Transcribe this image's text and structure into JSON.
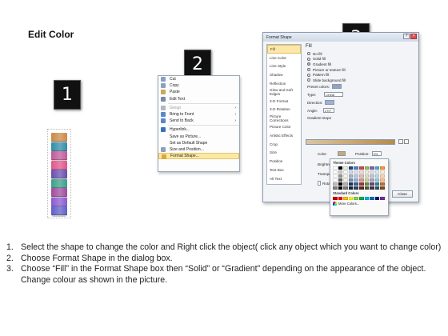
{
  "title": "Edit Color",
  "steps": [
    "1",
    "2",
    "3"
  ],
  "stack_colors": [
    "#c98a4a",
    "#2e8fa8",
    "#c05a9a",
    "#e0568a",
    "#6a4fb0",
    "#3d9e8a",
    "#a04c9c",
    "#8a5ad0",
    "#6060c8"
  ],
  "context_menu": {
    "items": [
      {
        "label": "Cut",
        "icon": "scissors-icon",
        "color": "#8aa0c0",
        "dim": false,
        "arrow": false
      },
      {
        "label": "Copy",
        "icon": "copy-icon",
        "color": "#8aa0c0",
        "dim": false,
        "arrow": false
      },
      {
        "label": "Paste",
        "icon": "paste-icon",
        "color": "#c9a85a",
        "dim": false,
        "arrow": false
      },
      {
        "label": "Edit Text",
        "icon": "edit-text-icon",
        "color": "#7a8aa8",
        "dim": false,
        "arrow": false
      },
      {
        "sep": true
      },
      {
        "label": "Group",
        "icon": "group-icon",
        "color": "#b0b8c4",
        "dim": true,
        "arrow": true
      },
      {
        "label": "Bring to Front",
        "icon": "bring-front-icon",
        "color": "#5b86c8",
        "dim": false,
        "arrow": true
      },
      {
        "label": "Send to Back",
        "icon": "send-back-icon",
        "color": "#5b86c8",
        "dim": false,
        "arrow": true
      },
      {
        "sep": true
      },
      {
        "label": "Hyperlink...",
        "icon": "hyperlink-icon",
        "color": "#3a6fc0",
        "dim": false,
        "arrow": false
      },
      {
        "label": "Save as Picture...",
        "icon": "",
        "color": "",
        "dim": false,
        "arrow": false
      },
      {
        "label": "Set as Default Shape",
        "icon": "",
        "color": "",
        "dim": false,
        "arrow": false
      },
      {
        "label": "Size and Position...",
        "icon": "size-icon",
        "color": "#8aa0c0",
        "dim": false,
        "arrow": false
      },
      {
        "label": "Format Shape...",
        "icon": "format-shape-icon",
        "color": "#d9a640",
        "dim": false,
        "arrow": false,
        "highlight": true
      }
    ]
  },
  "dialog": {
    "title": "Format Shape",
    "nav": [
      "Fill",
      "Line Color",
      "Line Style",
      "Shadow",
      "Reflection",
      "Glow and Soft Edges",
      "3-D Format",
      "3-D Rotation",
      "Picture Corrections",
      "Picture Color",
      "Artistic Effects",
      "Crop",
      "Size",
      "Position",
      "Text Box",
      "Alt Text"
    ],
    "fill_heading": "Fill",
    "fill_options": [
      {
        "label": "No fill",
        "selected": false
      },
      {
        "label": "Solid fill",
        "selected": false
      },
      {
        "label": "Gradient fill",
        "selected": true
      },
      {
        "label": "Picture or texture fill",
        "selected": false
      },
      {
        "label": "Pattern fill",
        "selected": false
      },
      {
        "label": "Slide background fill",
        "selected": false
      }
    ],
    "preset_colors_label": "Preset colors:",
    "type_label": "Type:",
    "type_value": "Linear",
    "direction_label": "Direction:",
    "angle_label": "Angle:",
    "angle_value": "270°",
    "gradient_stops_label": "Gradient stops",
    "color_label": "Color",
    "position_label": "Position:",
    "position_value": "0%",
    "brightness_label": "Brightness",
    "transparency_label": "Transpare",
    "rotate_label": "Rotate",
    "close_label": "Close"
  },
  "picker": {
    "theme_label": "Theme Colors",
    "standard_label": "Standard Colors",
    "more_label": "More Colors...",
    "theme_top": [
      "#ffffff",
      "#000000",
      "#eeece1",
      "#1f497d",
      "#4f81bd",
      "#c0504d",
      "#9bbb59",
      "#8064a2",
      "#4bacc6",
      "#f79646"
    ],
    "standard": [
      "#c00000",
      "#ff0000",
      "#ffc000",
      "#ffff00",
      "#92d050",
      "#00b050",
      "#00b0f0",
      "#0070c0",
      "#002060",
      "#7030a0"
    ]
  },
  "instructions": [
    {
      "n": "1.",
      "text": "Select the shape to change the color and Right click the object( click any object which you want to change color)"
    },
    {
      "n": "2.",
      "text": "Choose Format Shape in the dialog box."
    },
    {
      "n": "3.",
      "text": "Choose “Fill” in the Format Shape box then “Solid” or “Gradient” depending on the appearance of the object. Change colour as shown in the picture."
    }
  ]
}
